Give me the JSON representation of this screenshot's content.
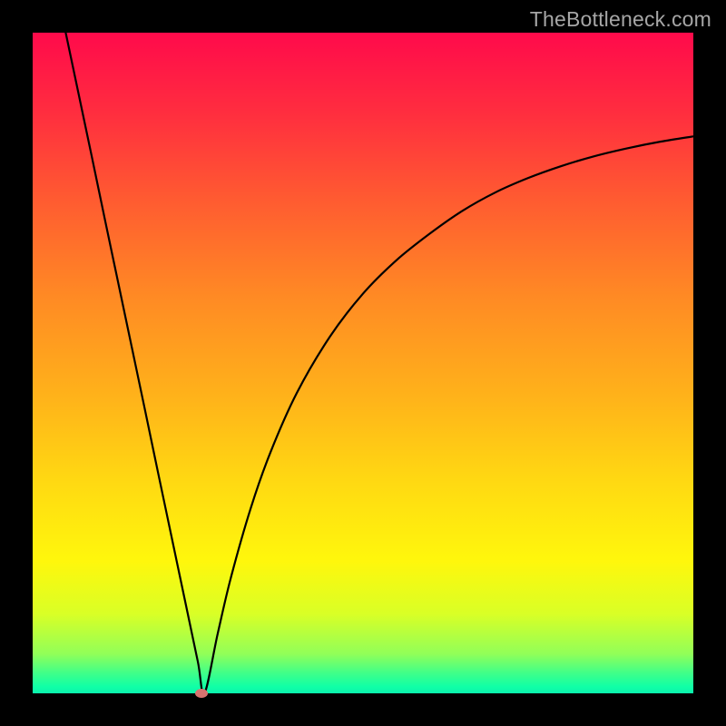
{
  "watermark": "TheBottleneck.com",
  "colors": {
    "frame": "#000000",
    "gradient_top": "#ff0a4b",
    "gradient_bottom": "#0bf3ae",
    "curve": "#000000",
    "marker": "#d6736f"
  },
  "chart_data": {
    "type": "line",
    "title": "",
    "xlabel": "",
    "ylabel": "",
    "xlim": [
      0,
      100
    ],
    "ylim": [
      0,
      100
    ],
    "grid": false,
    "legend": false,
    "series": [
      {
        "name": "left-branch",
        "x": [
          5.0,
          7.0,
          9.0,
          11.0,
          13.0,
          15.0,
          17.0,
          19.0,
          21.0,
          23.0,
          25.0,
          26.0
        ],
        "values": [
          100,
          90.5,
          81.0,
          71.4,
          61.9,
          52.4,
          42.9,
          33.3,
          23.8,
          14.3,
          4.8,
          0.0
        ]
      },
      {
        "name": "right-branch",
        "x": [
          26.0,
          28.0,
          30.0,
          33.0,
          36.0,
          40.0,
          45.0,
          50.0,
          55.0,
          60.0,
          65.0,
          70.0,
          75.0,
          80.0,
          85.0,
          90.0,
          95.0,
          100.0
        ],
        "values": [
          0.0,
          9.0,
          17.5,
          28.0,
          36.5,
          45.5,
          54.0,
          60.5,
          65.5,
          69.5,
          73.0,
          75.8,
          78.0,
          79.8,
          81.3,
          82.5,
          83.5,
          84.3
        ]
      }
    ],
    "marker": {
      "x": 25.5,
      "y": 0
    },
    "note": "x and y are in percent of plot area; y=0 is bottom (no bottleneck), y=100 is top (max bottleneck)."
  }
}
